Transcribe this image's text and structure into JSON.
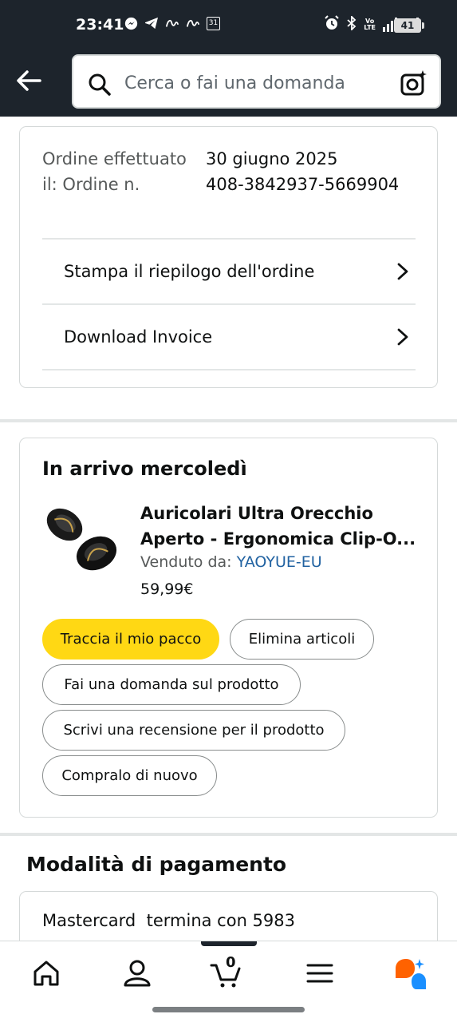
{
  "status_bar": {
    "time": "23:41",
    "battery": "41",
    "network": "4G"
  },
  "header": {
    "search_placeholder": "Cerca o fai una domanda"
  },
  "order_details": {
    "label_lines": "Ordine effettuato il: Ordine n.",
    "date": "30 giugno 2025",
    "order_number": "408-3842937-5669904",
    "print_summary_label": "Stampa il riepilogo dell'ordine",
    "download_invoice_label": "Download Invoice"
  },
  "arrival": {
    "title": "In arrivo mercoledì",
    "product_title": "Auricolari Ultra Orecchio Aperto - Ergonomica Clip-O...",
    "sold_by_label": "Venduto da: ",
    "seller": "YAOYUE-EU",
    "price": "59,99€",
    "buttons": {
      "track": "Traccia il mio pacco",
      "delete": "Elimina articoli",
      "ask": "Fai una domanda sul prodotto",
      "review": "Scrivi una recensione per il prodotto",
      "buy_again": "Compralo di nuovo"
    }
  },
  "payment": {
    "title": "Modalità di pagamento",
    "card_text": "Mastercard  termina con 5983"
  },
  "bottom_nav": {
    "cart_count": "0"
  },
  "colors": {
    "header_bg": "#1d242c",
    "primary_button": "#ffd814",
    "link": "#2162a1",
    "ai_orange": "#ff6200",
    "ai_blue": "#1a8fff"
  }
}
